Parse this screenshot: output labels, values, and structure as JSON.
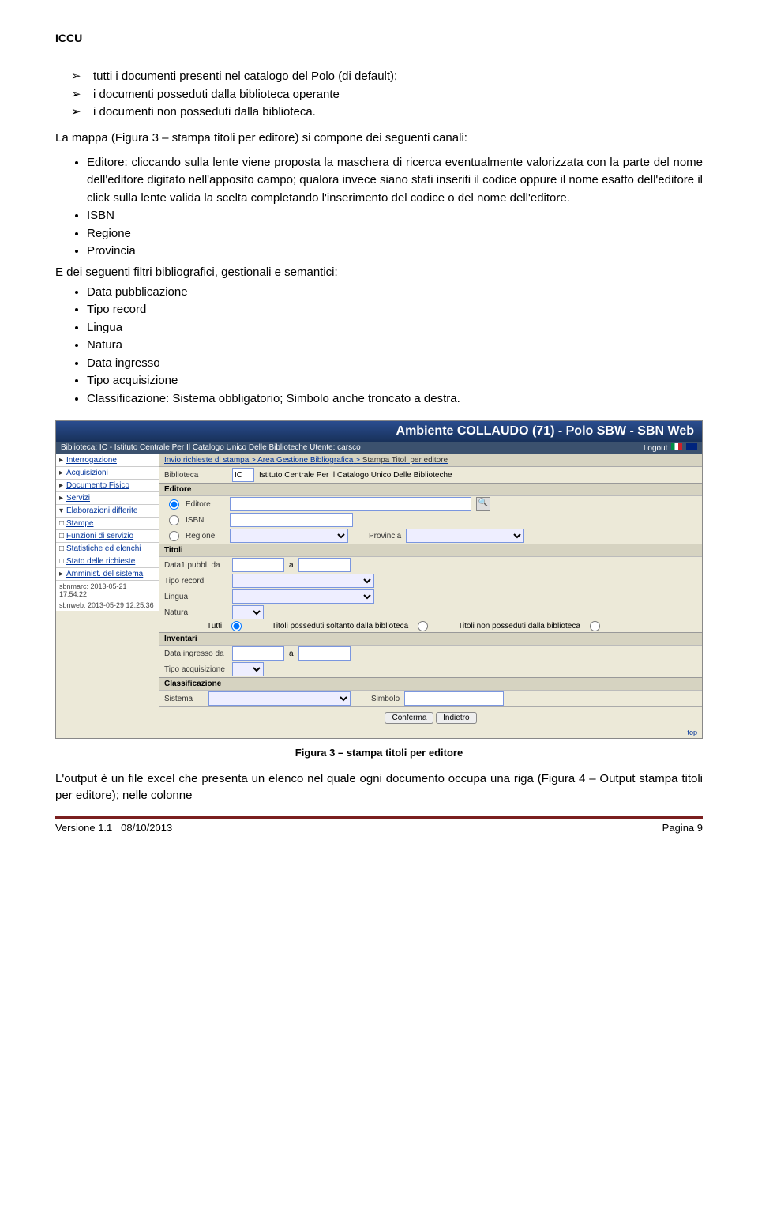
{
  "header": {
    "org": "ICCU"
  },
  "content": {
    "arrow_items": [
      "tutti i documenti presenti nel catalogo del Polo (di default);",
      "i documenti posseduti dalla biblioteca operante",
      "i documenti non posseduti dalla biblioteca."
    ],
    "intro_para": "La mappa (Figura 3 – stampa titoli per editore) si compone dei seguenti canali:",
    "channel_bullets": [
      "Editore: cliccando sulla lente viene proposta la maschera di ricerca eventualmente valorizzata con la parte del nome dell'editore digitato nell'apposito campo; qualora invece siano stati inseriti il codice oppure il nome esatto dell'editore il click sulla lente valida la scelta completando l'inserimento del codice o del nome dell'editore.",
      "ISBN",
      "Regione",
      "Provincia"
    ],
    "filters_intro": "E dei seguenti filtri bibliografici, gestionali e semantici:",
    "filters": [
      "Data pubblicazione",
      "Tipo record",
      "Lingua",
      "Natura",
      "Data ingresso",
      "Tipo acquisizione",
      "Classificazione: Sistema obbligatorio; Simbolo anche troncato a destra."
    ],
    "caption": "Figura 3 – stampa titoli per editore",
    "trailing_para": "L'output è un file excel che presenta un elenco nel quale ogni documento occupa una riga (Figura 4 – Output stampa titoli per editore); nelle colonne"
  },
  "app": {
    "title": "Ambiente COLLAUDO (71) - Polo SBW - SBN Web",
    "subheader_left": "Biblioteca: IC - Istituto Centrale Per Il Catalogo Unico Delle Biblioteche   Utente: carsco",
    "subheader_right": "Logout",
    "breadcrumb": {
      "a": "Invio richieste di stampa",
      "b": "Area Gestione Bibliografica",
      "c": "Stampa Titoli per editore"
    },
    "sidebar": {
      "items": [
        "Interrogazione",
        "Acquisizioni",
        "Documento Fisico",
        "Servizi",
        "Elaborazioni differite",
        "Stampe",
        "Funzioni di servizio",
        "Statistiche ed elenchi",
        "Stato delle richieste",
        "Amminist. del sistema"
      ],
      "time1": "sbnmarc: 2013-05-21 17:54:22",
      "time2": "sbnweb: 2013-05-29 12:25:36"
    },
    "form": {
      "biblioteca_label": "Biblioteca",
      "biblioteca_code": "IC",
      "biblioteca_name": "Istituto Centrale Per Il Catalogo Unico Delle Biblioteche",
      "sec_editore": "Editore",
      "r_editore": "Editore",
      "r_isbn": "ISBN",
      "r_regione": "Regione",
      "provincia": "Provincia",
      "sec_titoli": "Titoli",
      "data_pubbl": "Data1 pubbl. da",
      "a": "a",
      "tipo_record": "Tipo record",
      "lingua": "Lingua",
      "natura": "Natura",
      "filt_tutti": "Tutti",
      "filt_poss": "Titoli posseduti soltanto dalla biblioteca",
      "filt_non": "Titoli non posseduti dalla biblioteca",
      "sec_inventari": "Inventari",
      "data_ingresso": "Data ingresso da",
      "tipo_acq": "Tipo acquisizione",
      "sec_class": "Classificazione",
      "sistema": "Sistema",
      "simbolo": "Simbolo",
      "btn_conferma": "Conferma",
      "btn_indietro": "Indietro",
      "top": "top"
    }
  },
  "footer": {
    "left_a": "Versione 1.1",
    "left_b": "08/10/2013",
    "right": "Pagina 9"
  }
}
